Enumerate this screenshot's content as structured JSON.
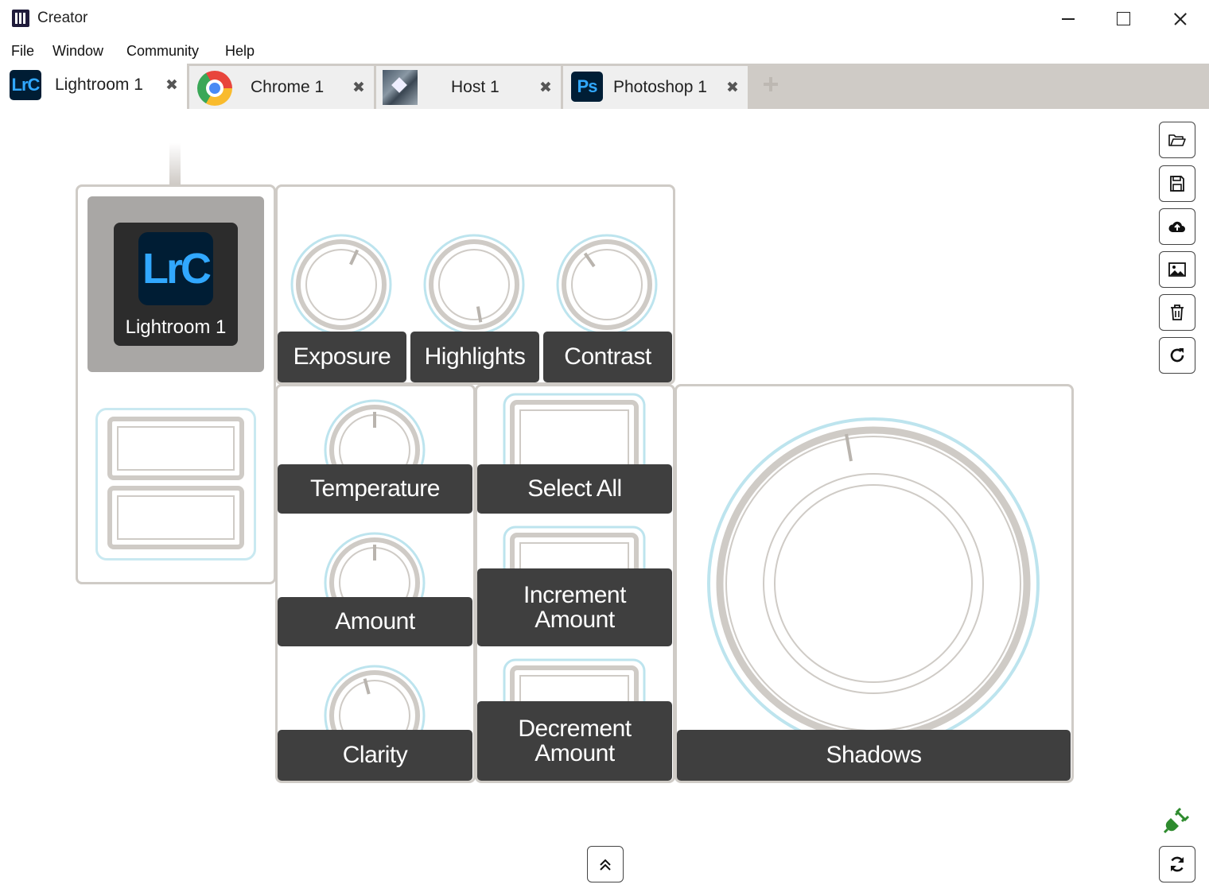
{
  "window": {
    "title": "Creator"
  },
  "menu": [
    "File",
    "Window",
    "Community",
    "Help"
  ],
  "tabs": [
    {
      "label": "Lightroom 1",
      "icon": "lightroom-classic-icon",
      "icon_text": "LrC",
      "active": true
    },
    {
      "label": "Chrome 1",
      "icon": "chrome-icon",
      "active": false
    },
    {
      "label": "Host 1",
      "icon": "host-icon",
      "active": false
    },
    {
      "label": "Photoshop 1",
      "icon": "photoshop-icon",
      "icon_text": "Ps",
      "active": false
    }
  ],
  "tab_close_glyph": "✖",
  "toolbar": [
    "open-folder-icon",
    "save-icon",
    "cloud-upload-icon",
    "image-icon",
    "trash-icon",
    "refresh-icon"
  ],
  "device": {
    "profile_tile": {
      "logo_text": "LrC",
      "label": "Lightroom 1"
    },
    "top_dials": [
      {
        "label": "Exposure",
        "angle": 25
      },
      {
        "label": "Highlights",
        "angle": 170
      },
      {
        "label": "Contrast",
        "angle": -35
      }
    ],
    "left_dials": [
      {
        "label": "Temperature",
        "angle": 0
      },
      {
        "label": "Amount",
        "angle": 0
      },
      {
        "label": "Clarity",
        "angle": -15
      }
    ],
    "buttons": [
      {
        "label": "Select All"
      },
      {
        "label_line1": "Increment",
        "label_line2": "Amount"
      },
      {
        "label_line1": "Decrement",
        "label_line2": "Amount"
      }
    ],
    "wheel": {
      "label": "Shadows"
    }
  },
  "colors": {
    "panel_border": "#cfcbc6",
    "ring_accent": "#bde4ee",
    "label_bg": "#3f3f3f",
    "lrc_blue": "#31a8ff",
    "lrc_bg": "#001d34",
    "plug_green": "#2e8b2e"
  }
}
